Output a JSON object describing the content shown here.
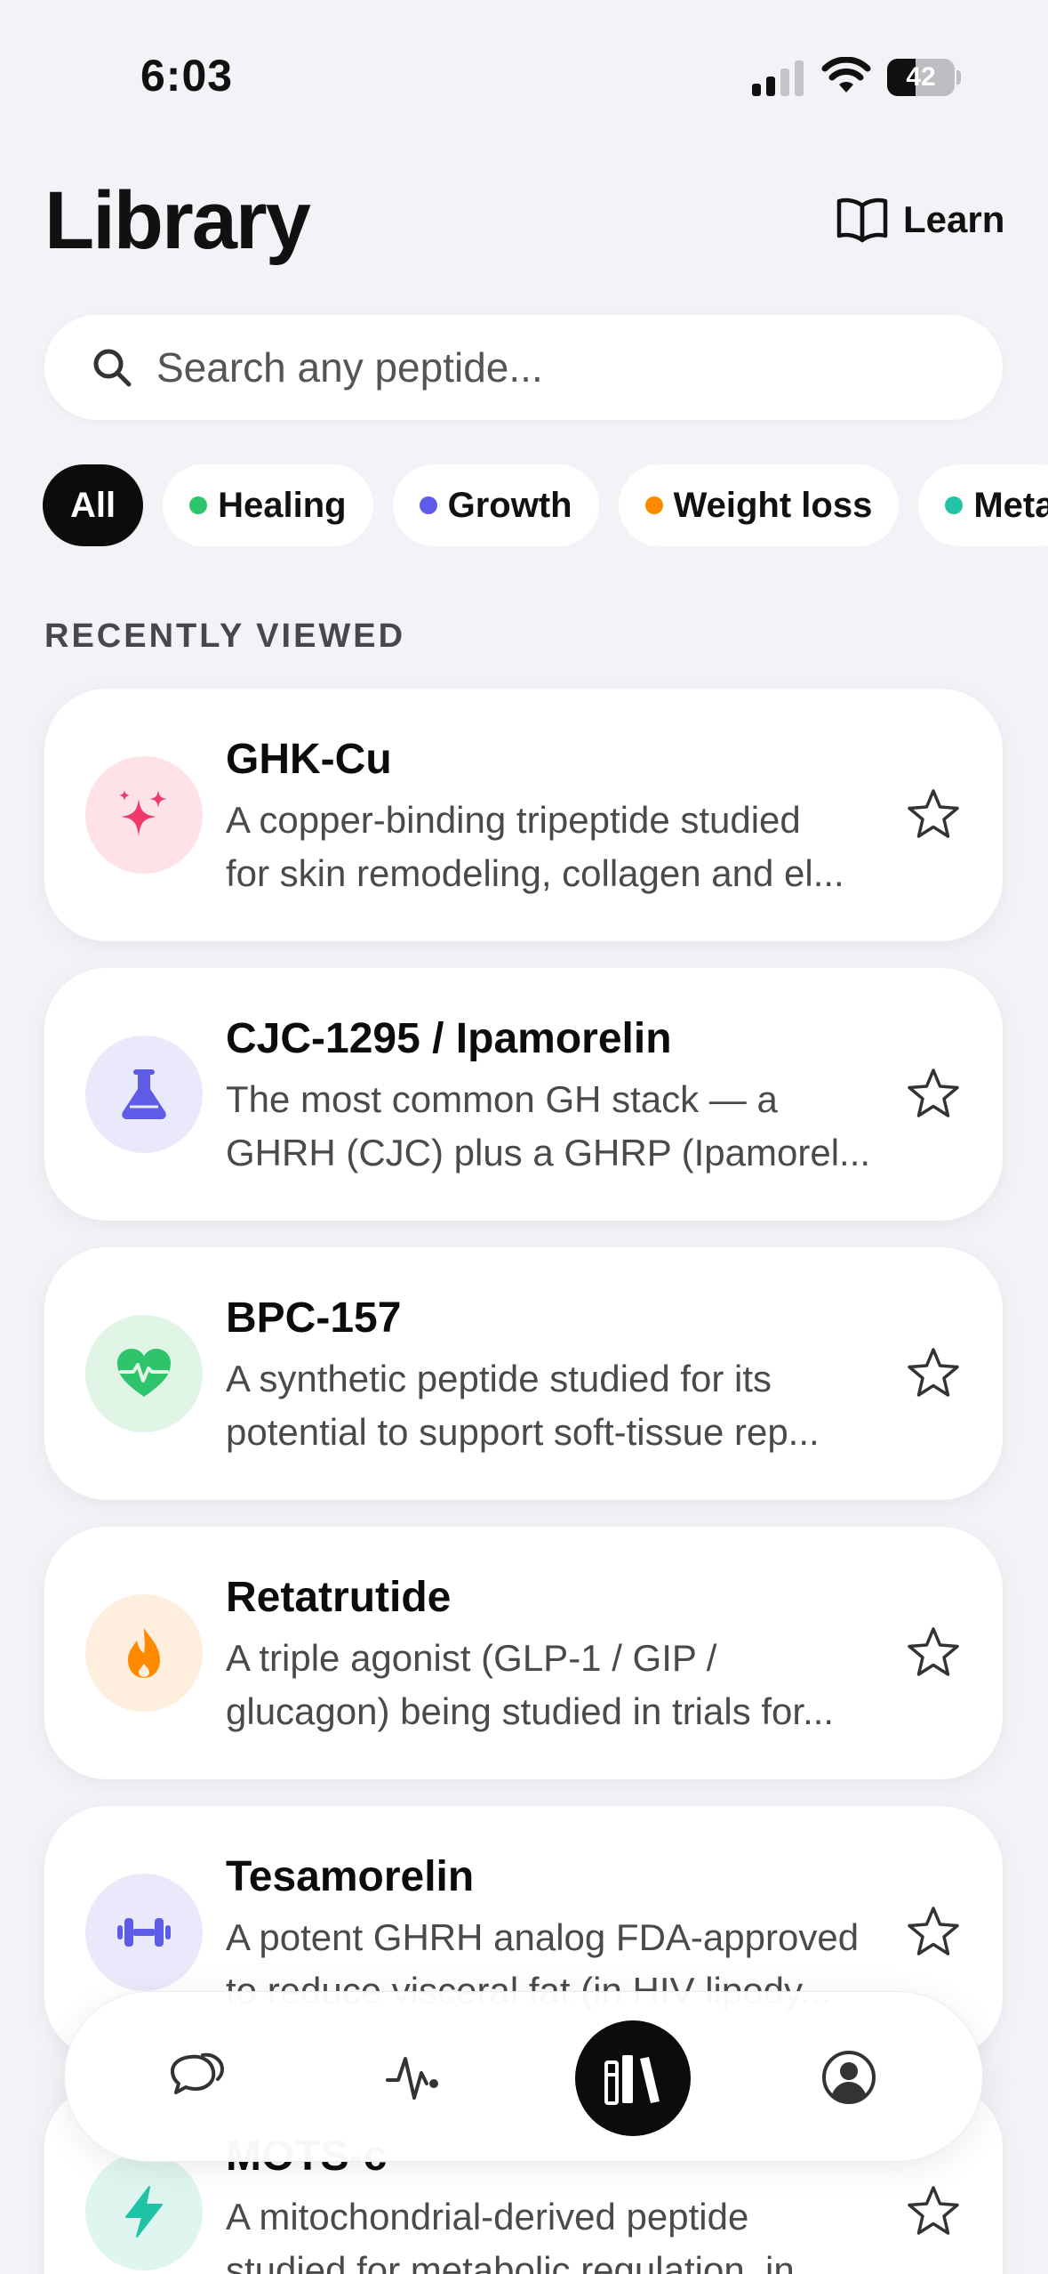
{
  "status_bar": {
    "time": "6:03",
    "battery_level": "42",
    "battery_fraction": 0.42,
    "signal_icon": "cellular-signal-icon",
    "wifi_icon": "wifi-icon"
  },
  "header": {
    "title": "Library",
    "learn_label": "Learn",
    "learn_icon": "book-open-icon"
  },
  "search": {
    "placeholder": "Search any peptide...",
    "value": ""
  },
  "filters": [
    {
      "label": "All",
      "active": true,
      "dot": ""
    },
    {
      "label": "Healing",
      "active": false,
      "dot": "#2ec46b"
    },
    {
      "label": "Growth",
      "active": false,
      "dot": "#5e5ce6"
    },
    {
      "label": "Weight loss",
      "active": false,
      "dot": "#ff8a00"
    },
    {
      "label": "Meta",
      "active": false,
      "dot": "#20c3a6"
    }
  ],
  "section": {
    "recently_viewed": "RECENTLY VIEWED"
  },
  "peptides": [
    {
      "name": "GHK-Cu",
      "desc_line1": "A copper-binding tripeptide studied",
      "desc_line2": "for skin remodeling, collagen and el...",
      "icon": "sparkles-icon",
      "icon_bg": "#fde3e8",
      "icon_color": "#f0386b"
    },
    {
      "name": "CJC-1295 / Ipamorelin",
      "desc_line1": "The most common GH stack — a",
      "desc_line2": "GHRH (CJC) plus a GHRP (Ipamorel...",
      "icon": "flask-icon",
      "icon_bg": "#e9e9fb",
      "icon_color": "#5e5ce6"
    },
    {
      "name": "BPC-157",
      "desc_line1": "A synthetic peptide studied for its",
      "desc_line2": "potential to support soft-tissue rep...",
      "icon": "heart-pulse-icon",
      "icon_bg": "#e0f5e6",
      "icon_color": "#2ec46b"
    },
    {
      "name": "Retatrutide",
      "desc_line1": "A triple agonist (GLP-1 / GIP /",
      "desc_line2": "glucagon) being studied in trials for...",
      "icon": "flame-icon",
      "icon_bg": "#fdeedd",
      "icon_color": "#ff8a00"
    },
    {
      "name": "Tesamorelin",
      "desc_line1": "A potent GHRH analog FDA-approved",
      "desc_line2": "to reduce visceral fat (in HIV lipody...",
      "icon": "dumbbell-icon",
      "icon_bg": "#e9e9fb",
      "icon_color": "#5e5ce6"
    },
    {
      "name": "MOTS-c",
      "desc_line1": "A mitochondrial-derived peptide",
      "desc_line2": "studied for metabolic regulation, in...",
      "icon": "lightning-icon",
      "icon_bg": "#dff5f0",
      "icon_color": "#20c3a6"
    }
  ],
  "bottom_nav": [
    {
      "icon": "chat-bubbles-icon",
      "active": false
    },
    {
      "icon": "activity-pulse-icon",
      "active": false
    },
    {
      "icon": "library-books-icon",
      "active": true
    },
    {
      "icon": "profile-icon",
      "active": false
    }
  ]
}
